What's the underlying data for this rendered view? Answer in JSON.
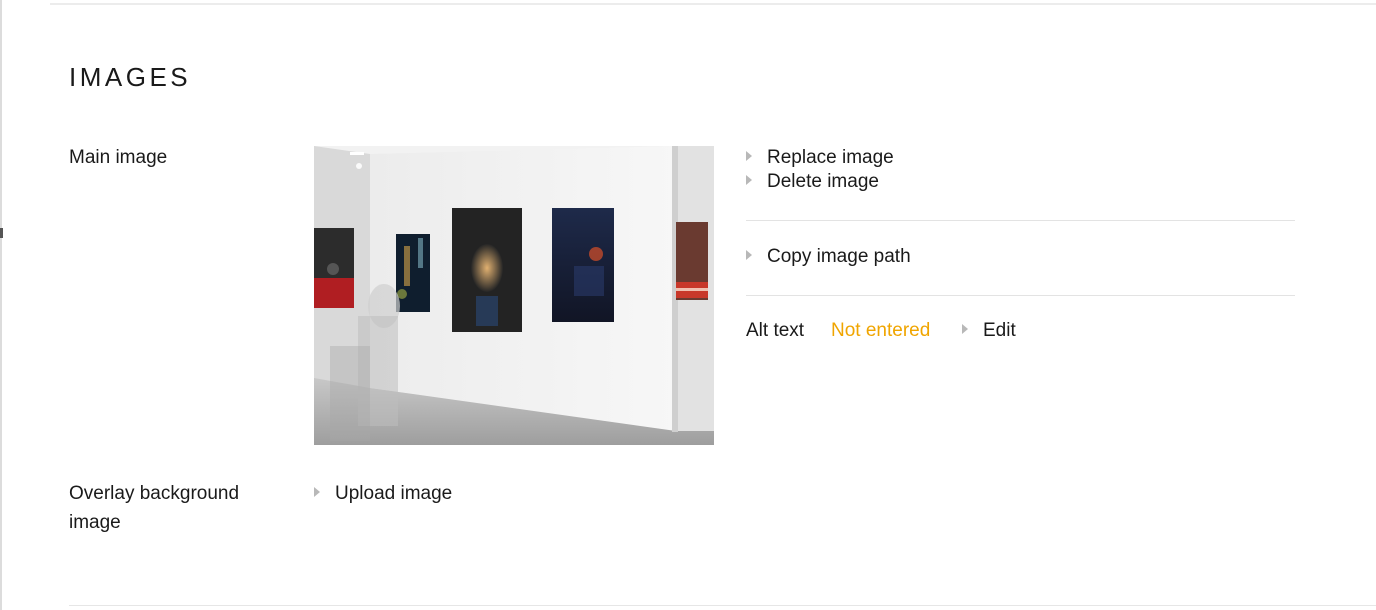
{
  "section": {
    "title": "IMAGES"
  },
  "main_image": {
    "label": "Main image",
    "actions": {
      "replace": "Replace image",
      "delete": "Delete image",
      "copy_path": "Copy image path"
    },
    "alt_text": {
      "label": "Alt text",
      "status": "Not entered",
      "edit": "Edit"
    }
  },
  "overlay_background": {
    "label": "Overlay background image",
    "upload": "Upload image"
  },
  "colors": {
    "status_warning": "#f0a500",
    "arrow": "#b8b8b8",
    "divider": "#e3e3e3"
  }
}
